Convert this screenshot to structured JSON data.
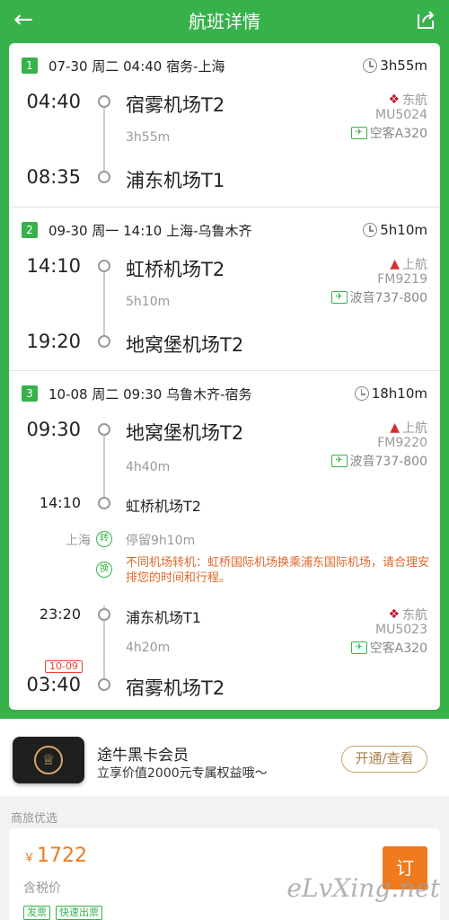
{
  "header": {
    "title": "航班详情"
  },
  "segments": [
    {
      "num": "1",
      "summary": "07-30 周二 04:40 宿务-上海",
      "duration": "3h55m",
      "dep_time": "04:40",
      "dep_airport": "宿雾机场T2",
      "fly": "3h55m",
      "arr_time": "08:35",
      "arr_airport": "浦东机场T1",
      "airline": "东航",
      "flight_no": "MU5024",
      "aircraft": "空客A320"
    },
    {
      "num": "2",
      "summary": "09-30 周一 14:10 上海-乌鲁木齐",
      "duration": "5h10m",
      "dep_time": "14:10",
      "dep_airport": "虹桥机场T2",
      "fly": "5h10m",
      "arr_time": "19:20",
      "arr_airport": "地窝堡机场T2",
      "airline": "上航",
      "flight_no": "FM9219",
      "aircraft": "波音737-800"
    },
    {
      "num": "3",
      "summary": "10-08 周二 09:30 乌鲁木齐-宿务",
      "duration": "18h10m",
      "dep_time": "09:30",
      "dep_airport": "地窝堡机场T2",
      "fly": "4h40m",
      "mid_time": "14:10",
      "mid_airport": "虹桥机场T2",
      "transfer_city": "上海",
      "transfer_icon": "转",
      "stopover": "停留9h10m",
      "change_icon": "换",
      "warning": "不同机场转机：虹桥国际机场换乘浦东国际机场，请合理安排您的时间和行程。",
      "airline": "上航",
      "flight_no": "FM9220",
      "aircraft": "波音737-800",
      "leg2_dep_time": "23:20",
      "leg2_dep_airport": "浦东机场T1",
      "leg2_fly": "4h20m",
      "leg2_airline": "东航",
      "leg2_flight_no": "MU5023",
      "leg2_aircraft": "空客A320",
      "arr_date_badge": "10-09",
      "arr_time": "03:40",
      "arr_airport": "宿雾机场T2"
    }
  ],
  "member": {
    "title": "途牛黑卡会员",
    "subtitle": "立享价值2000元专属权益哦～",
    "button": "开通/查看"
  },
  "business": {
    "label": "商旅优选",
    "currency": "￥",
    "price": "1722",
    "tax_note": "含税价",
    "tags": [
      "发票",
      "快速出票"
    ],
    "book_button": "订"
  },
  "watermark": "eLvXing.net",
  "colors": {
    "green": "#37b24b",
    "orange": "#f07a1e",
    "east_airline_red": "#c8102e",
    "shanghai_airline_red": "#d32f2f"
  }
}
